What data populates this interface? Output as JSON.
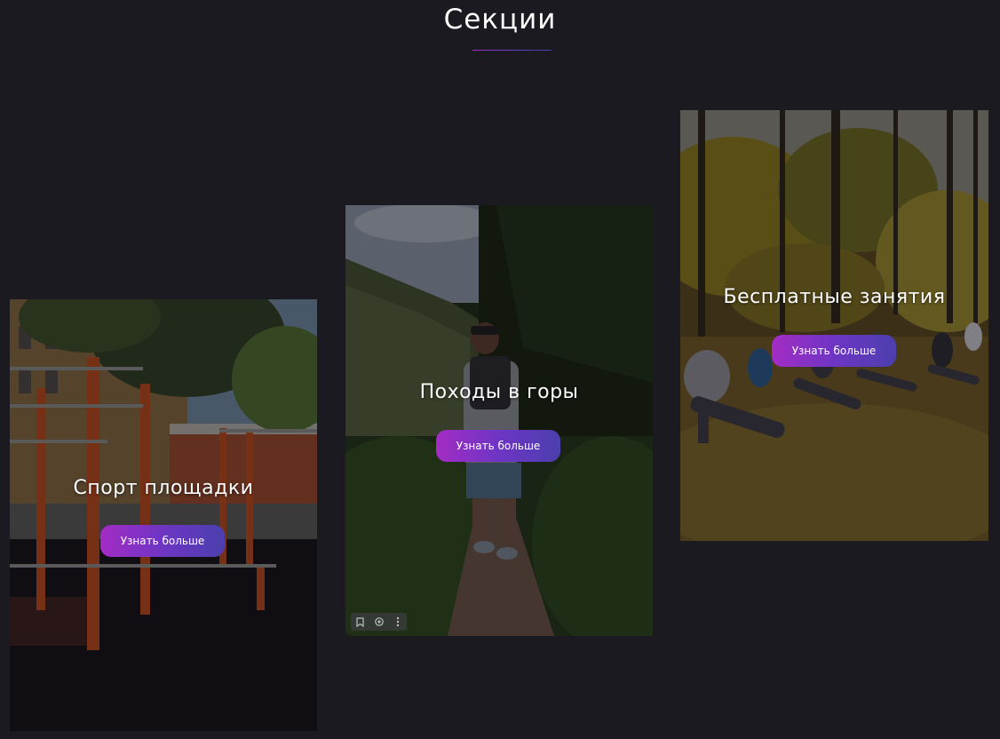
{
  "page": {
    "title": "Секции"
  },
  "colors": {
    "background": "#1c1a21",
    "accent_gradient_start": "#a32cc4",
    "accent_gradient_end": "#4b3fae"
  },
  "cards": [
    {
      "title": "Спорт площадки",
      "button_label": "Узнать больше",
      "image": "outdoor-workout-bars-photo"
    },
    {
      "title": "Походы в горы",
      "button_label": "Узнать больше",
      "image": "mountain-trail-hiker-photo"
    },
    {
      "title": "Бесплатные занятия",
      "button_label": "Узнать больше",
      "image": "park-group-stretching-photo"
    }
  ],
  "image_toolbar": {
    "icons": [
      "bookmark-icon",
      "lens-icon",
      "more-vertical-icon"
    ]
  }
}
